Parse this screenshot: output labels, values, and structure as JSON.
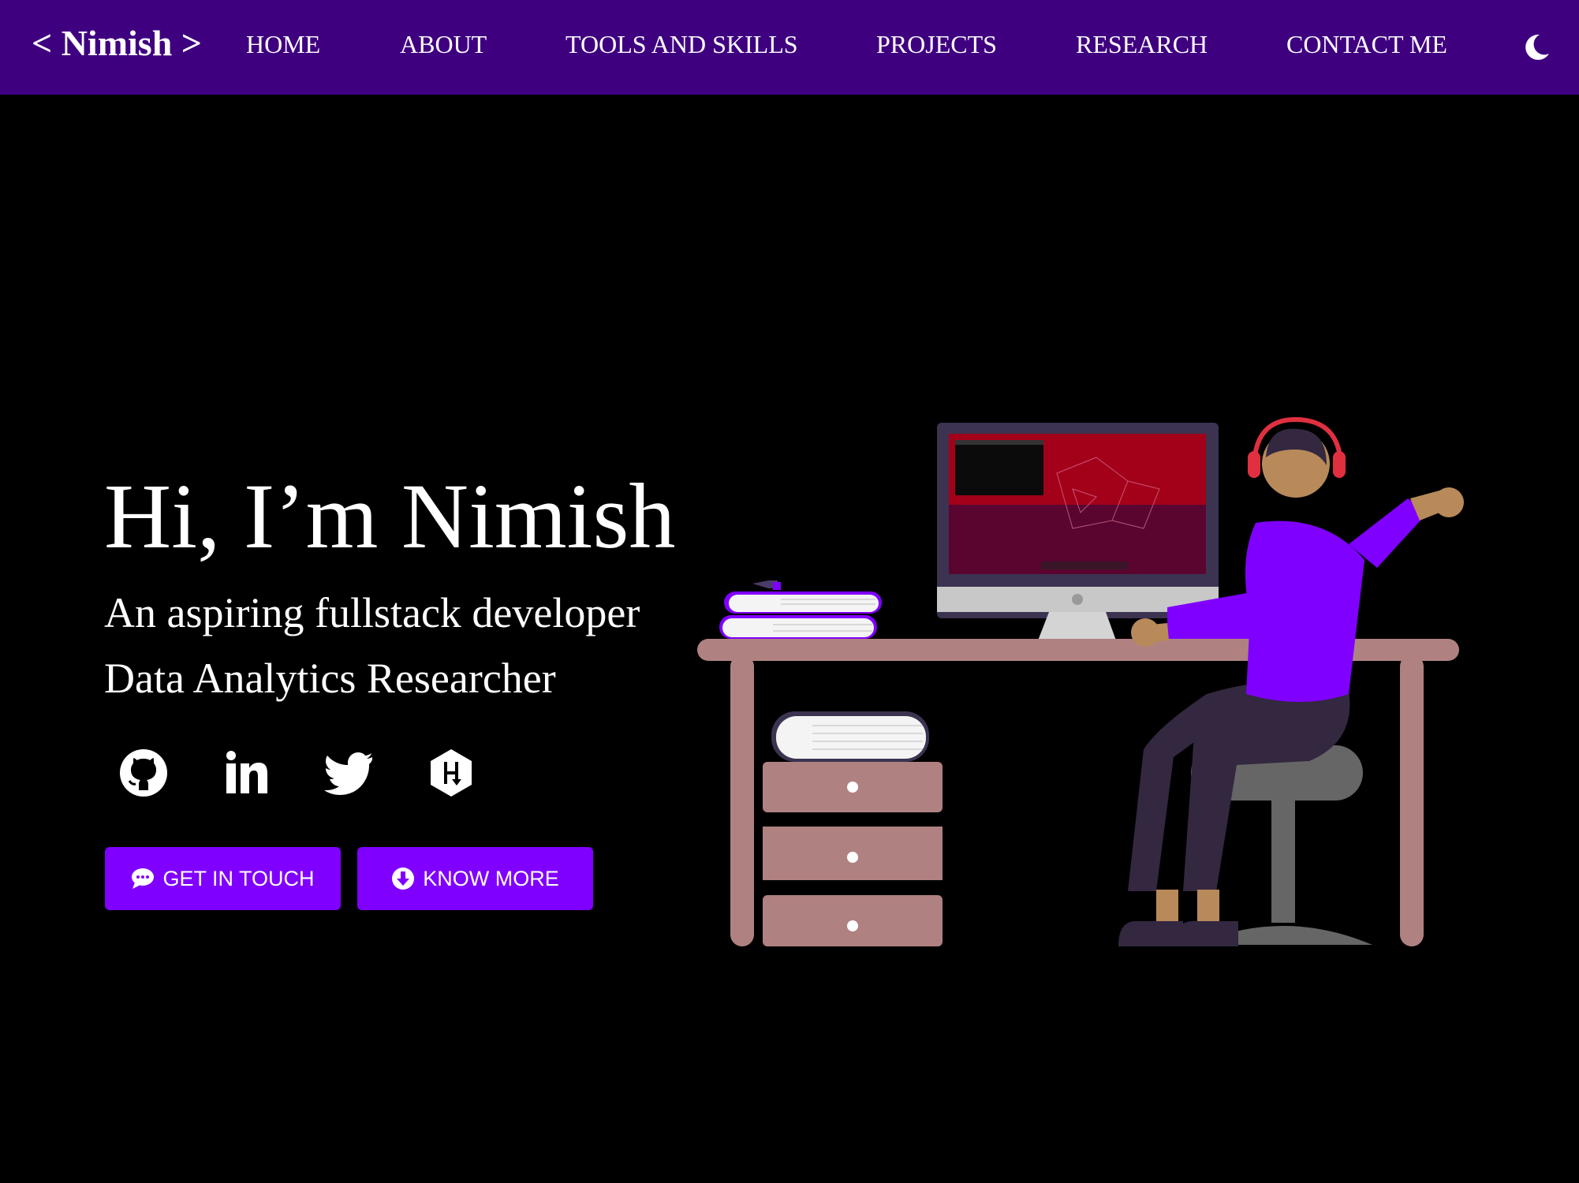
{
  "nav": {
    "brand": "< Nimish >",
    "links": [
      "HOME",
      "ABOUT",
      "TOOLS AND SKILLS",
      "PROJECTS",
      "RESEARCH",
      "CONTACT ME"
    ],
    "theme_icon": "moon-icon"
  },
  "hero": {
    "title": "Hi, I’m Nimish",
    "subtitle_1": "An aspiring fullstack developer",
    "subtitle_2": "Data Analytics Researcher"
  },
  "social": [
    {
      "icon": "github-icon"
    },
    {
      "icon": "linkedin-icon"
    },
    {
      "icon": "twitter-icon"
    },
    {
      "icon": "hashnode-icon"
    }
  ],
  "buttons": {
    "get_in_touch": "GET IN TOUCH",
    "know_more": "KNOW MORE"
  },
  "colors": {
    "navbar": "#3f0080",
    "accent": "#8000ff",
    "background": "#000000",
    "text": "#ffffff"
  }
}
